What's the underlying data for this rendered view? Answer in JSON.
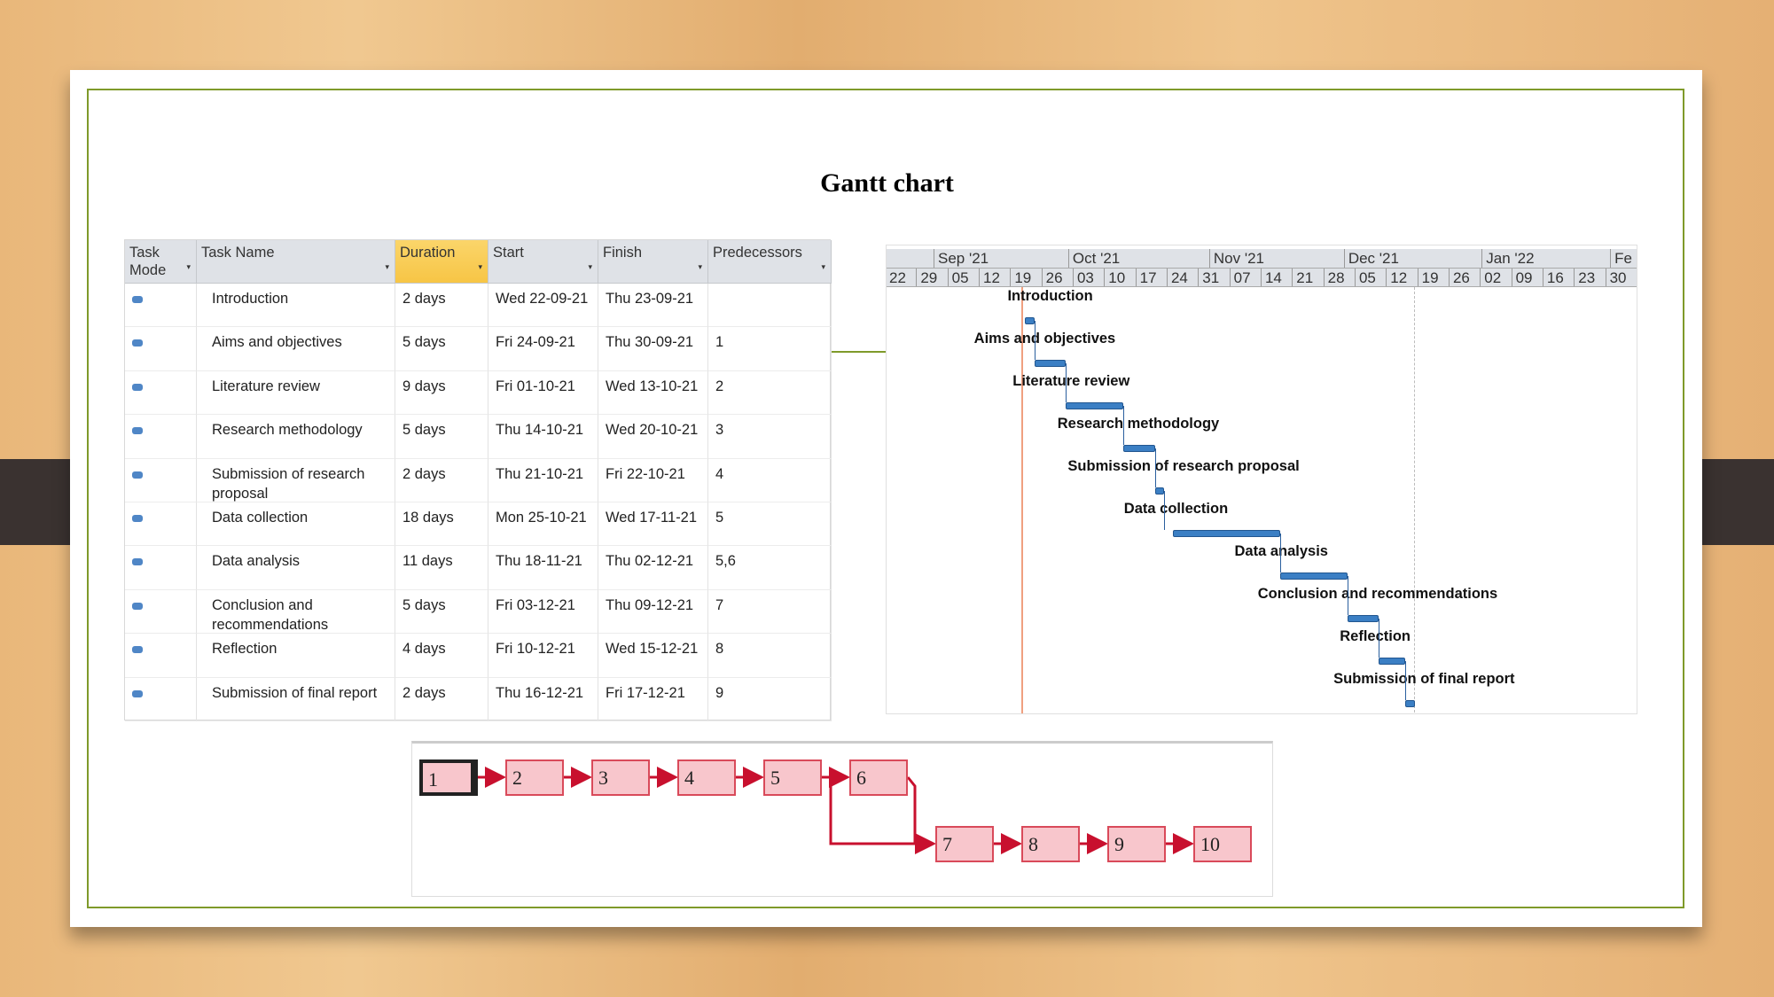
{
  "title": "Gantt chart",
  "table": {
    "headers": [
      "Task Mode",
      "Task Name",
      "Duration",
      "Start",
      "Finish",
      "Predecessors"
    ],
    "rows": [
      {
        "name": "Introduction",
        "duration": "2 days",
        "start": "Wed 22-09-21",
        "finish": "Thu 23-09-21",
        "pred": ""
      },
      {
        "name": "Aims and objectives",
        "duration": "5 days",
        "start": "Fri 24-09-21",
        "finish": "Thu 30-09-21",
        "pred": "1"
      },
      {
        "name": "Literature review",
        "duration": "9 days",
        "start": "Fri 01-10-21",
        "finish": "Wed 13-10-21",
        "pred": "2"
      },
      {
        "name": "Research methodology",
        "duration": "5 days",
        "start": "Thu 14-10-21",
        "finish": "Wed 20-10-21",
        "pred": "3"
      },
      {
        "name": "Submission of research proposal",
        "duration": "2 days",
        "start": "Thu 21-10-21",
        "finish": "Fri 22-10-21",
        "pred": "4"
      },
      {
        "name": "Data collection",
        "duration": "18 days",
        "start": "Mon 25-10-21",
        "finish": "Wed 17-11-21",
        "pred": "5"
      },
      {
        "name": "Data analysis",
        "duration": "11 days",
        "start": "Thu 18-11-21",
        "finish": "Thu 02-12-21",
        "pred": "5,6"
      },
      {
        "name": "Conclusion and recommendations",
        "duration": "5 days",
        "start": "Fri 03-12-21",
        "finish": "Thu 09-12-21",
        "pred": "7"
      },
      {
        "name": "Reflection",
        "duration": "4 days",
        "start": "Fri 10-12-21",
        "finish": "Wed 15-12-21",
        "pred": "8"
      },
      {
        "name": "Submission of final report",
        "duration": "2 days",
        "start": "Thu 16-12-21",
        "finish": "Fri 17-12-21",
        "pred": "9"
      }
    ]
  },
  "gantt": {
    "months": [
      "",
      "Sep '21",
      "Oct '21",
      "Nov '21",
      "Dec '21",
      "Jan '22",
      "Fe"
    ],
    "weeks": [
      "22",
      "29",
      "05",
      "12",
      "19",
      "26",
      "03",
      "10",
      "17",
      "24",
      "31",
      "07",
      "14",
      "21",
      "28",
      "05",
      "12",
      "19",
      "26",
      "02",
      "09",
      "16",
      "23",
      "30"
    ],
    "bar_color": "#3b7fc4"
  },
  "network": {
    "nodes": [
      "1",
      "2",
      "3",
      "4",
      "5",
      "6",
      "7",
      "8",
      "9",
      "10"
    ],
    "box_color": "#f8c6cc",
    "arrow_color": "#c8102e"
  }
}
